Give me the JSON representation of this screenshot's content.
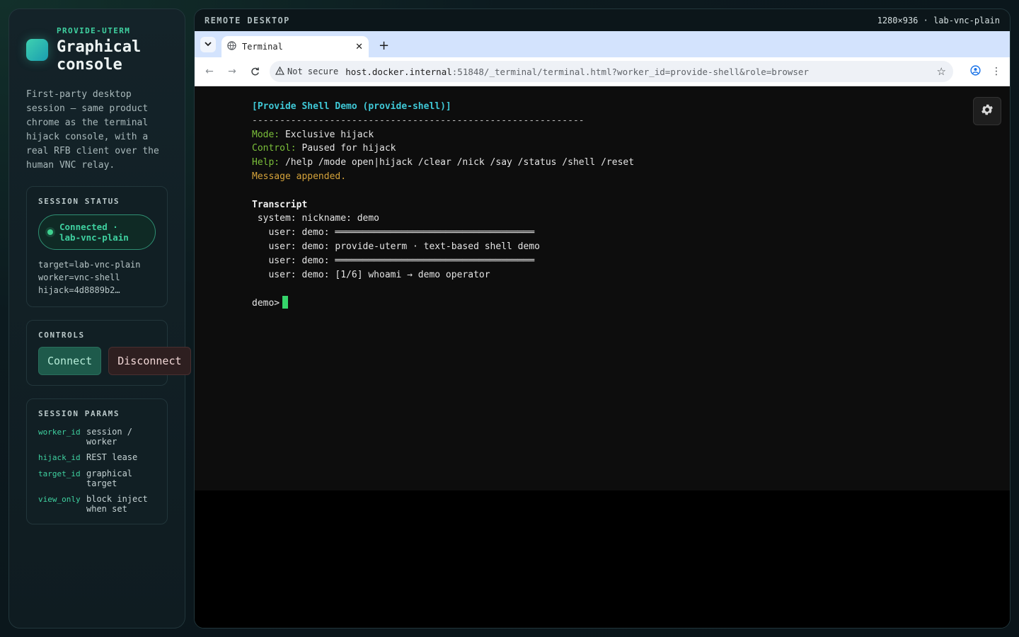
{
  "sidebar": {
    "kicker": "PROVIDE-UTERM",
    "title_line1": "Graphical",
    "title_line2": "console",
    "intro": "First-party desktop session — same product chrome as the terminal hijack console, with a real RFB client over the human VNC relay.",
    "status": {
      "title": "SESSION STATUS",
      "pill_line1": "Connected ·",
      "pill_line2": "lab-vnc-plain",
      "lines": [
        "target=lab-vnc-plain",
        "worker=vnc-shell",
        "hijack=4d8889b2…"
      ]
    },
    "controls": {
      "title": "CONTROLS",
      "connect_label": "Connect",
      "disconnect_label": "Disconnect"
    },
    "params": {
      "title": "SESSION PARAMS",
      "items": [
        {
          "key": "worker_id",
          "value": "session / worker"
        },
        {
          "key": "hijack_id",
          "value": "REST lease"
        },
        {
          "key": "target_id",
          "value": "graphical target"
        },
        {
          "key": "view_only",
          "value": "block inject when set"
        }
      ]
    }
  },
  "remote": {
    "label": "REMOTE DESKTOP",
    "meta": "1280×936 · lab-vnc-plain"
  },
  "browser": {
    "tab_title": "Terminal",
    "not_secure": "Not secure",
    "url_host": "host.docker.internal",
    "url_rest": ":51848/_terminal/terminal.html?worker_id=provide-shell&role=browser"
  },
  "terminal": {
    "title": "[Provide Shell Demo (provide-shell)]",
    "rule": "------------------------------------------------------------",
    "mode_key": "Mode:",
    "mode_val": " Exclusive hijack",
    "control_key": "Control:",
    "control_val": " Paused for hijack",
    "help_key": "Help:",
    "help_val": " /help /mode open|hijack /clear /nick /say /status /shell /reset",
    "message": "Message appended.",
    "transcript_heading": "Transcript",
    "transcript": [
      " system: nickname: demo",
      "   user: demo: ════════════════════════════════════",
      "   user: demo: provide-uterm · text-based shell demo",
      "   user: demo: ════════════════════════════════════",
      "   user: demo: [1/6] whoami → demo operator"
    ],
    "prompt": "demo>"
  },
  "colors": {
    "accent": "#3fd1a0",
    "terminal_title": "#3fc8d6",
    "terminal_key": "#7bbf3a",
    "terminal_warn": "#d4a23a",
    "cursor": "#35d46a"
  }
}
